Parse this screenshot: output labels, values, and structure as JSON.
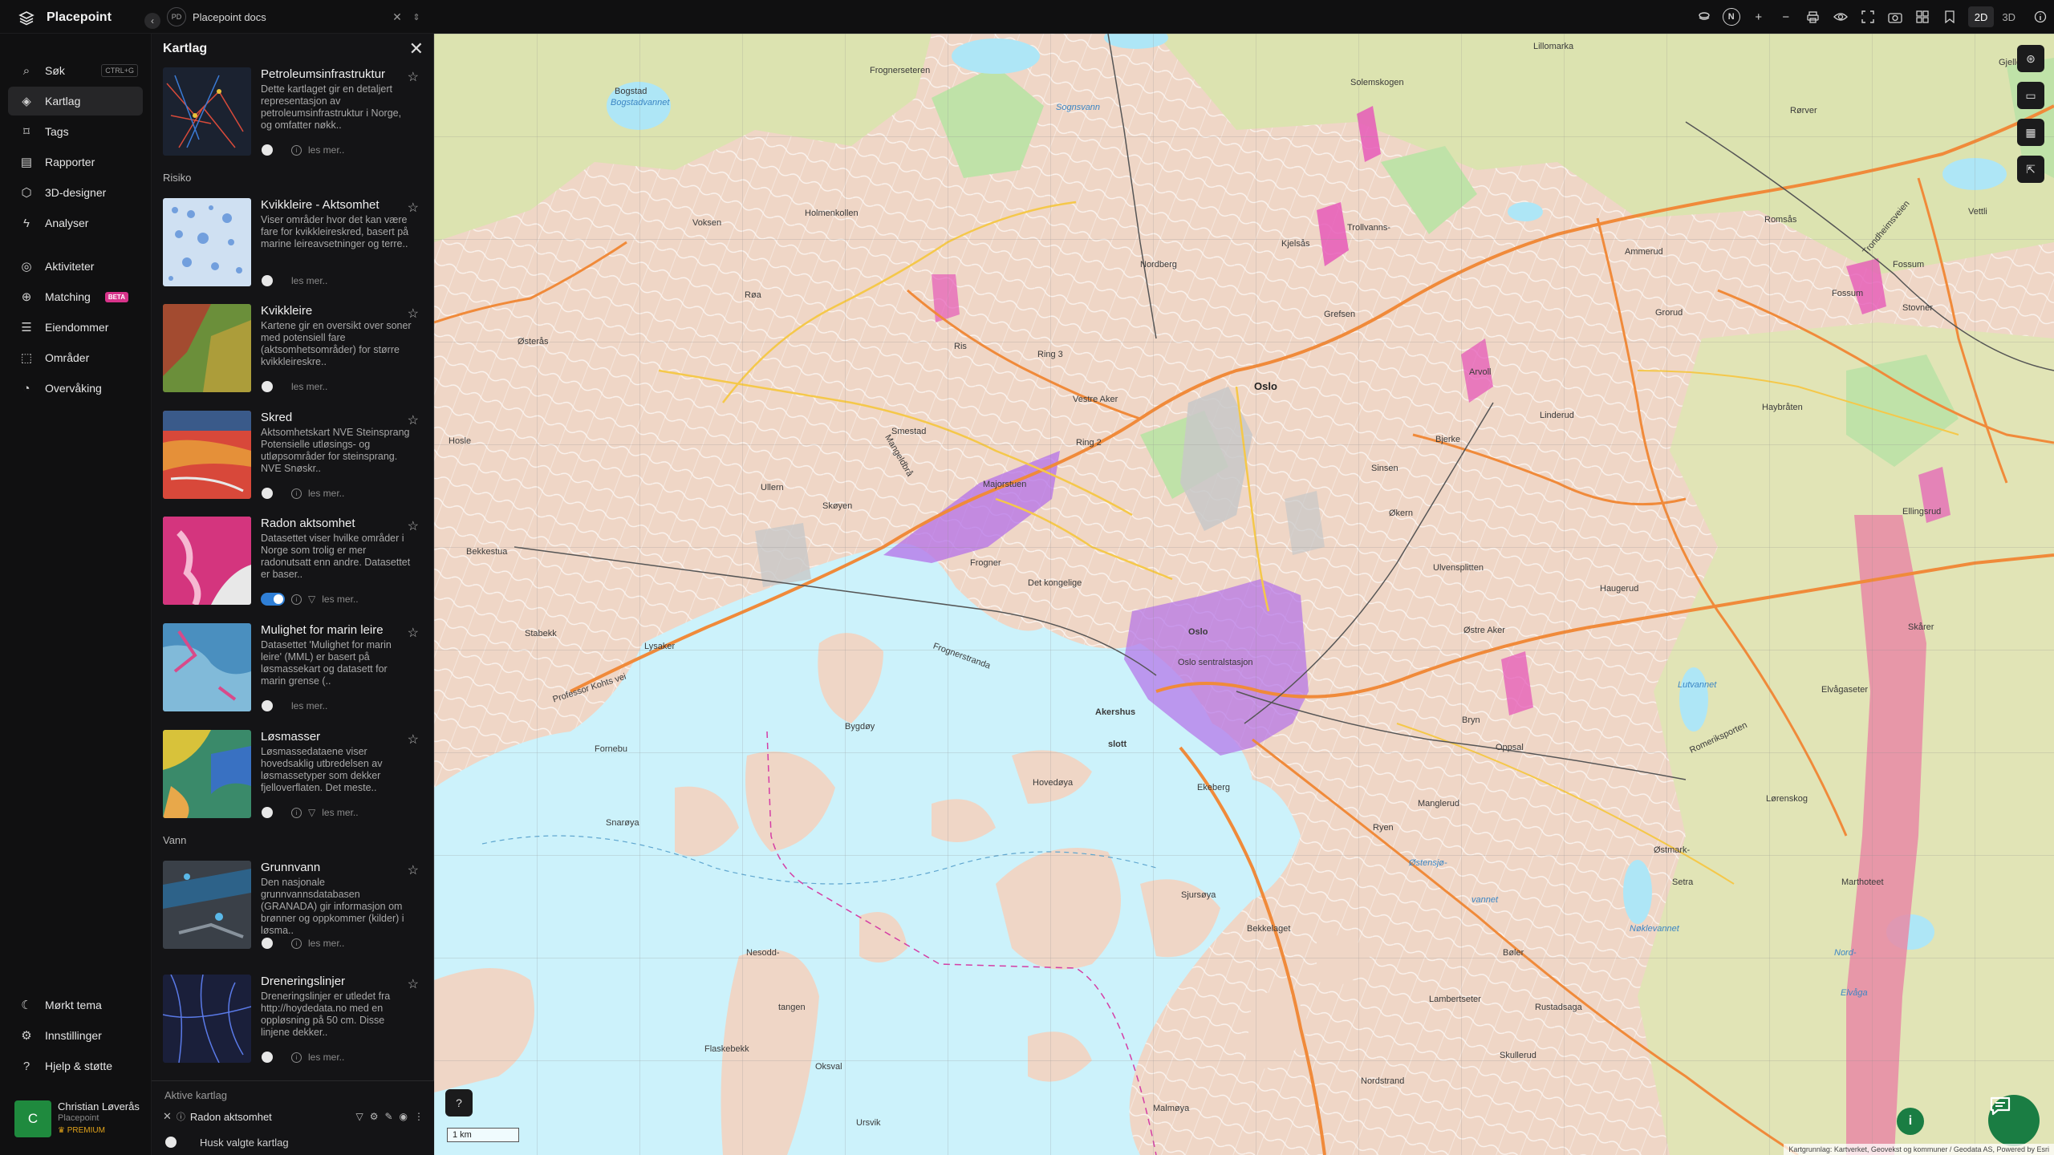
{
  "app": {
    "title": "Placepoint"
  },
  "document": {
    "badge": "PD",
    "name": "Placepoint docs"
  },
  "toolbar": {
    "north": "N",
    "view_2d": "2D",
    "view_3d": "3D"
  },
  "nav": {
    "items": [
      {
        "label": "Søk",
        "icon": "search-icon",
        "shortcut": "CTRL+G"
      },
      {
        "label": "Kartlag",
        "icon": "layers-icon"
      },
      {
        "label": "Tags",
        "icon": "bookmark-icon"
      },
      {
        "label": "Rapporter",
        "icon": "chart-icon"
      },
      {
        "label": "3D-designer",
        "icon": "cube-icon"
      },
      {
        "label": "Analyser",
        "icon": "bolt-icon"
      },
      {
        "label": "Aktiviteter",
        "icon": "activity-icon"
      },
      {
        "label": "Matching",
        "icon": "match-icon",
        "badge": "BETA"
      },
      {
        "label": "Eiendommer",
        "icon": "list-icon"
      },
      {
        "label": "Områder",
        "icon": "area-icon"
      },
      {
        "label": "Overvåking",
        "icon": "monitor-icon"
      }
    ],
    "bottom": [
      {
        "label": "Mørkt tema",
        "icon": "moon-icon"
      },
      {
        "label": "Innstillinger",
        "icon": "gear-icon"
      },
      {
        "label": "Hjelp & støtte",
        "icon": "help-icon"
      }
    ]
  },
  "user": {
    "initial": "C",
    "name": "Christian Løverås",
    "org": "Placepoint",
    "plan": "PREMIUM"
  },
  "panel": {
    "title": "Kartlag",
    "sections": {
      "risiko": "Risiko",
      "vann": "Vann"
    },
    "read_more": "les mer..",
    "layers": [
      {
        "title": "Petroleumsinfrastruktur",
        "desc": "Dette kartlaget gir en detaljert representasjon av petroleumsinfrastruktur i Norge, og omfatter nøkk..",
        "enabled": false
      },
      {
        "title": "Kvikkleire - Aktsomhet",
        "desc": "Viser områder hvor det kan være fare for kvikkleireskred, basert på marine leireavsetninger og terre..",
        "enabled": false
      },
      {
        "title": "Kvikkleire",
        "desc": "Kartene gir en oversikt over soner med potensiell fare (aktsomhetsområder) for større kvikkleireskre..",
        "enabled": false
      },
      {
        "title": "Skred",
        "desc": "Aktsomhetskart NVE Steinsprang Potensielle utløsings- og utløpsområder for steinsprang. NVE Snøskr..",
        "enabled": false
      },
      {
        "title": "Radon aktsomhet",
        "desc": "Datasettet viser hvilke områder i Norge som trolig er mer radonutsatt enn andre. Datasettet er baser..",
        "enabled": true
      },
      {
        "title": "Mulighet for marin leire",
        "desc": "Datasettet 'Mulighet for marin leire' (MML) er basert på løsmassekart og datasett for marin grense (..",
        "enabled": false
      },
      {
        "title": "Løsmasser",
        "desc": "Løsmassedataene viser hovedsaklig utbredelsen av løsmassetyper som dekker fjelloverflaten. Det meste..",
        "enabled": false
      },
      {
        "title": "Grunnvann",
        "desc": "Den nasjonale grunnvannsdatabasen (GRANADA) gir informasjon om brønner og oppkommer (kilder) i løsma..",
        "enabled": false
      },
      {
        "title": "Dreneringslinjer",
        "desc": "Dreneringslinjer er utledet fra http://hoydedata.no med en oppløsning på 50 cm. Disse linjene dekker..",
        "enabled": false
      }
    ],
    "active": {
      "label": "Aktive kartlag",
      "item": "Radon aktsomhet",
      "remember": "Husk valgte kartlag"
    }
  },
  "map": {
    "scale": "1 km",
    "attribution": "Kartgrunnlag: Kartverket, Geovekst og kommuner / Geodata AS, Powered by Esri",
    "labels": [
      "Oslo",
      "Oslo sentralstasjon",
      "Akershus",
      "slott",
      "Det kongelige",
      "Majorstuen",
      "Vestre Aker",
      "Frogner",
      "Holmenkollen",
      "Voksen",
      "Røa",
      "Ris",
      "Smestad",
      "Ullern",
      "Skøyen",
      "Bygdøy",
      "Lysaker",
      "Stabekk",
      "Bekkestua",
      "Hosle",
      "Østerås",
      "Fornebu",
      "Snarøya",
      "Nesodd-",
      "tangen",
      "Oksval",
      "Flaskebekk",
      "Ursvik",
      "Malmøya",
      "Sjursøya",
      "Ekeberg",
      "Bekkelaget",
      "Nordstrand",
      "Lambertseter",
      "Rustadsaga",
      "Skullerud",
      "Bøler",
      "Ryen",
      "Manglerud",
      "Oppsal",
      "Bryn",
      "Haugerud",
      "Østre Aker",
      "Ulvensplitten",
      "Økern",
      "Linderud",
      "Arvoll",
      "Grefsen",
      "Nordberg",
      "Kjelsås",
      "Trollvanns-",
      "Ammerud",
      "Grorud",
      "Romsås",
      "Fossum",
      "Stovner",
      "Haybråten",
      "Ellingsrud",
      "Skårer",
      "Elvågaseter",
      "Lørenskog",
      "Nord-",
      "Elvåga",
      "Marthoteet",
      "Setra",
      "Østmark-",
      "Nøklevannet",
      "Østensjø-",
      "vannet",
      "Lutvannet",
      "Frognerseteren",
      "Sognsvann",
      "Solemskogen",
      "Lillomarka",
      "Gjelleråsen",
      "Vettli",
      "Rørver",
      "Ring 2",
      "Ring 3",
      "Professor Kohts vei",
      "Frognerstranda",
      "Romeriksporten",
      "Trondheimsveien",
      "Mangeldbrå",
      "Bogstadvannet",
      "Bogstad",
      "Fossum",
      "Bjerke",
      "Sinsen",
      "Hovedøya"
    ]
  },
  "colors": {
    "accent": "#2f7fd6",
    "beta": "#d8338a",
    "brand_green": "#1a7d43",
    "premium": "#e0a21a"
  }
}
